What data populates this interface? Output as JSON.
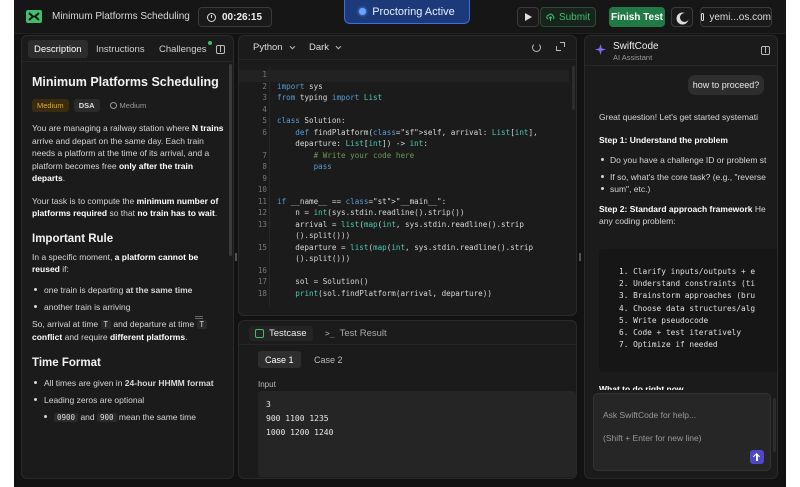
{
  "header": {
    "app_title": "Minimum Platforms Scheduling",
    "timer": "00:26:15",
    "proctoring": "Proctoring Active",
    "submit_label": "Submit",
    "finish_label": "Finish Test",
    "user_label": "yemi...os.com",
    "brand_color": "#3fbf6b",
    "proctor_color": "#3d6fe0"
  },
  "left_panel": {
    "tabs": [
      "Description",
      "Instructions",
      "Challenges"
    ],
    "title": "Minimum Platforms Scheduling",
    "badges": {
      "level": "Medium",
      "topic": "DSA",
      "difficulty": "Medium"
    },
    "p1": [
      "You are managing a railway station where ",
      "N trains",
      " arrive and depart on the same day. Each train needs a platform at the time of its arrival, and a platform becomes free ",
      "only after the train departs",
      "."
    ],
    "p2": [
      "Your task is to compute the ",
      "minimum number of platforms required",
      " so that ",
      "no train has to wait",
      "."
    ],
    "h_rule": "Important Rule",
    "rule_intro": [
      "In a specific moment, ",
      "a platform cannot be reused",
      " if:"
    ],
    "rule_items": [
      [
        "one train is departing ",
        "at the same time"
      ],
      [
        "another train is arriving"
      ]
    ],
    "rule_note": [
      "So, arrival at time ",
      "T",
      " and departure at time ",
      "T",
      " ",
      "conflict",
      " and require ",
      "different platforms",
      "."
    ],
    "h_time": "Time Format",
    "time_items": [
      [
        "All times are given in ",
        "24-hour HHMM format"
      ],
      [
        "Leading zeros are optional"
      ]
    ],
    "time_sub": [
      "0900",
      "and",
      "900",
      "mean the same time"
    ]
  },
  "editor": {
    "language": "Python",
    "theme": "Dark",
    "lines": [
      {
        "n": "1",
        "t": ""
      },
      {
        "n": "2",
        "t": "import sys"
      },
      {
        "n": "3",
        "t": "from typing import List"
      },
      {
        "n": "4",
        "t": ""
      },
      {
        "n": "5",
        "t": "class Solution:"
      },
      {
        "n": "6",
        "t": "    def findPlatform(self, arrival: List[int],"
      },
      {
        "n": "",
        "t": "    departure: List[int]) -> int:"
      },
      {
        "n": "7",
        "t": "        # Write your code here"
      },
      {
        "n": "8",
        "t": "        pass"
      },
      {
        "n": "9",
        "t": ""
      },
      {
        "n": "10",
        "t": ""
      },
      {
        "n": "11",
        "t": "if __name__ == \"__main__\":"
      },
      {
        "n": "12",
        "t": "    n = int(sys.stdin.readline().strip())"
      },
      {
        "n": "13",
        "t": "    arrival = list(map(int, sys.stdin.readline().strip"
      },
      {
        "n": "",
        "t": "    ().split()))"
      },
      {
        "n": "15",
        "t": "    departure = list(map(int, sys.stdin.readline().strip"
      },
      {
        "n": "",
        "t": "    ().split()))"
      },
      {
        "n": "16",
        "t": ""
      },
      {
        "n": "17",
        "t": "    sol = Solution()"
      },
      {
        "n": "18",
        "t": "    print(sol.findPlatform(arrival, departure))"
      }
    ]
  },
  "testcase": {
    "tabs": [
      "Testcase",
      "Test Result"
    ],
    "cases": [
      "Case 1",
      "Case 2"
    ],
    "input_label": "Input",
    "input_lines": [
      "3",
      "900 1100 1235",
      "1000 1200 1240"
    ]
  },
  "chat": {
    "title": "SwiftCode",
    "subtitle": "AI Assistant",
    "user_msg": "how to proceed?",
    "intro": "Great question! Let's get started systemati",
    "step1": "Step 1: Understand the problem",
    "step1_items": [
      "Do you have a challenge ID or problem st",
      "If so, what's the core task? (e.g., \"reverse",
      "sum\", etc.)"
    ],
    "step2_bold": "Step 2: Standard approach framework",
    "step2_rest": " He",
    "step2_line2": "any coding problem:",
    "code_lines": [
      "1. Clarify inputs/outputs + e",
      "2. Understand constraints (ti",
      "3. Brainstorm approaches (bru",
      "4. Choose data structures/alg",
      "5. Write pseudocode",
      "6. Code + test iteratively",
      "7. Optimize if needed"
    ],
    "cut_text": "What to do right now",
    "composer_placeholder": "Ask SwiftCode for help...",
    "composer_hint": "(Shift + Enter for new line)"
  }
}
